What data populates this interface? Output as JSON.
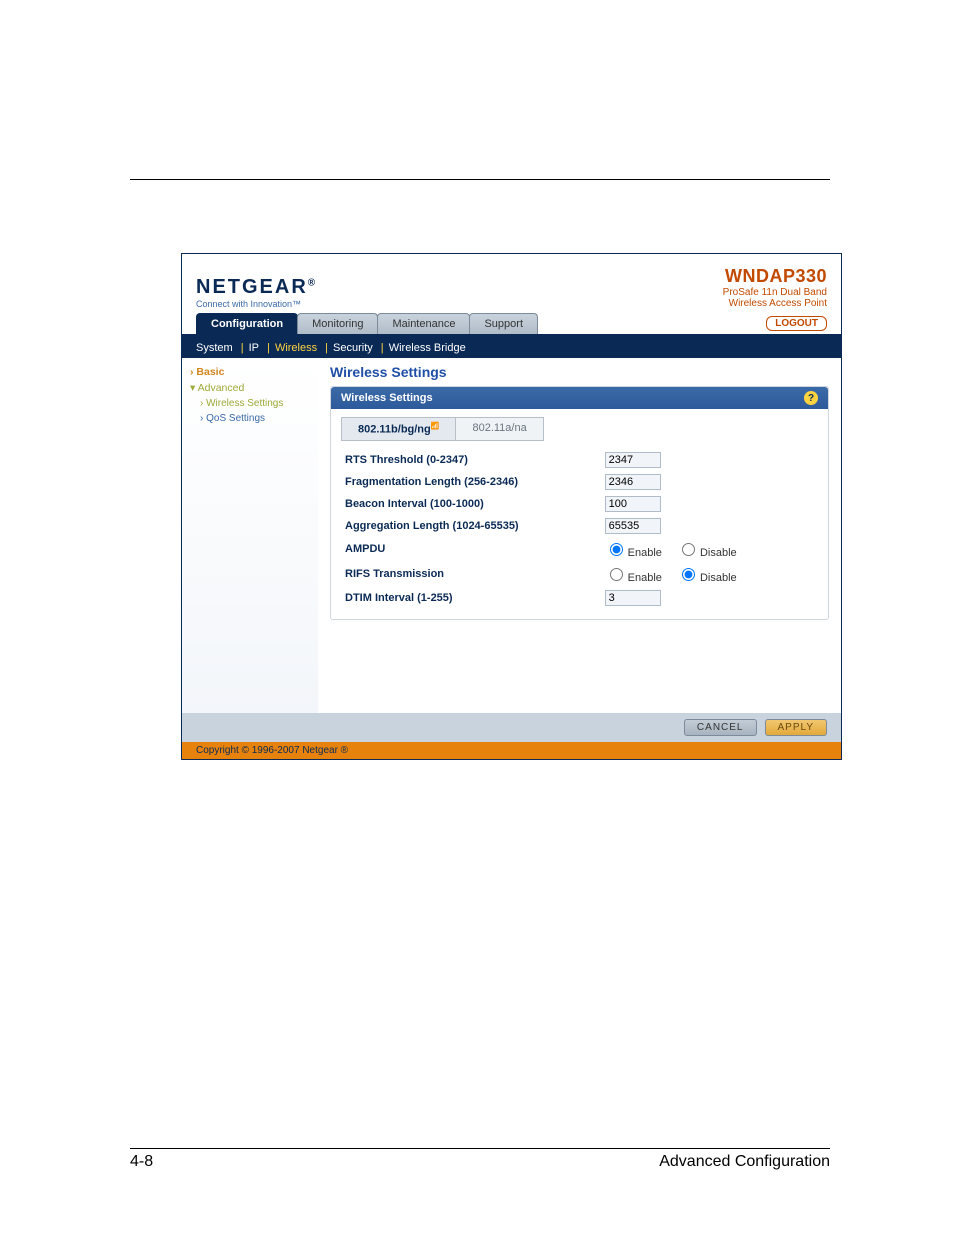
{
  "brand": {
    "logo": "NETGEAR",
    "tag": "Connect with Innovation™"
  },
  "product": {
    "model": "WNDAP330",
    "line1": "ProSafe 11n Dual Band",
    "line2": "Wireless Access Point"
  },
  "logout": "LOGOUT",
  "main_tabs": {
    "items": [
      "Configuration",
      "Monitoring",
      "Maintenance",
      "Support"
    ],
    "active": 0
  },
  "subnav": {
    "items": [
      "System",
      "IP",
      "Wireless",
      "Security",
      "Wireless Bridge"
    ],
    "active": 2
  },
  "sidebar": {
    "basic": "Basic",
    "advanced": "Advanced",
    "wireless_settings": "Wireless Settings",
    "qos_settings": "QoS Settings"
  },
  "content": {
    "title": "Wireless Settings",
    "panel_title": "Wireless Settings",
    "help": "?",
    "band_tabs": {
      "a": "802.11b/bg/ng",
      "b": "802.11a/na",
      "active": 0
    },
    "rows": {
      "rts": {
        "label": "RTS Threshold (0-2347)",
        "value": "2347"
      },
      "frag": {
        "label": "Fragmentation Length (256-2346)",
        "value": "2346"
      },
      "beacon": {
        "label": "Beacon Interval (100-1000)",
        "value": "100"
      },
      "agg": {
        "label": "Aggregation Length (1024-65535)",
        "value": "65535"
      },
      "ampdu": {
        "label": "AMPDU",
        "enable": "Enable",
        "disable": "Disable",
        "selected": "enable"
      },
      "rifs": {
        "label": "RIFS Transmission",
        "enable": "Enable",
        "disable": "Disable",
        "selected": "disable"
      },
      "dtim": {
        "label": "DTIM Interval (1-255)",
        "value": "3"
      }
    }
  },
  "footer_buttons": {
    "cancel": "CANCEL",
    "apply": "APPLY"
  },
  "copyright": "Copyright © 1996-2007 Netgear ®",
  "page_no": "4-8",
  "page_section": "Advanced Configuration"
}
